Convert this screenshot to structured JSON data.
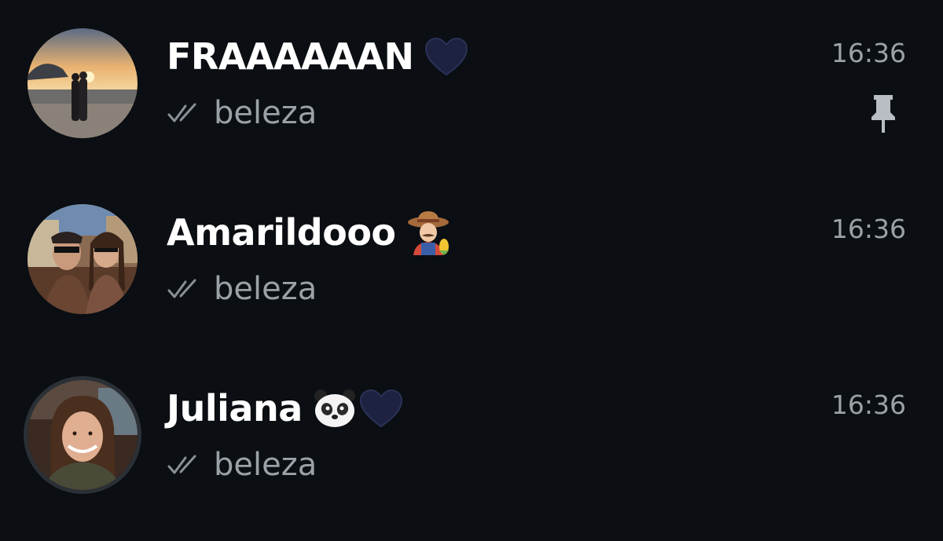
{
  "chats": [
    {
      "name": "FRAAAAAAN",
      "name_emoji": "blue-heart-emoji",
      "time": "16:36",
      "preview": "beleza",
      "read_status": "double-check-icon",
      "pinned": true
    },
    {
      "name": "Amarildooo",
      "name_emoji": "farmer-emoji",
      "time": "16:36",
      "preview": "beleza",
      "read_status": "double-check-icon",
      "pinned": false
    },
    {
      "name": "Juliana",
      "name_emoji": "panda-face-emoji blue-heart-emoji",
      "time": "16:36",
      "preview": "beleza",
      "read_status": "double-check-icon",
      "pinned": false
    }
  ],
  "colors": {
    "background": "#0b0e12",
    "name": "#ffffff",
    "secondary_text": "#9aa1a7",
    "heart": "#1c2240"
  }
}
